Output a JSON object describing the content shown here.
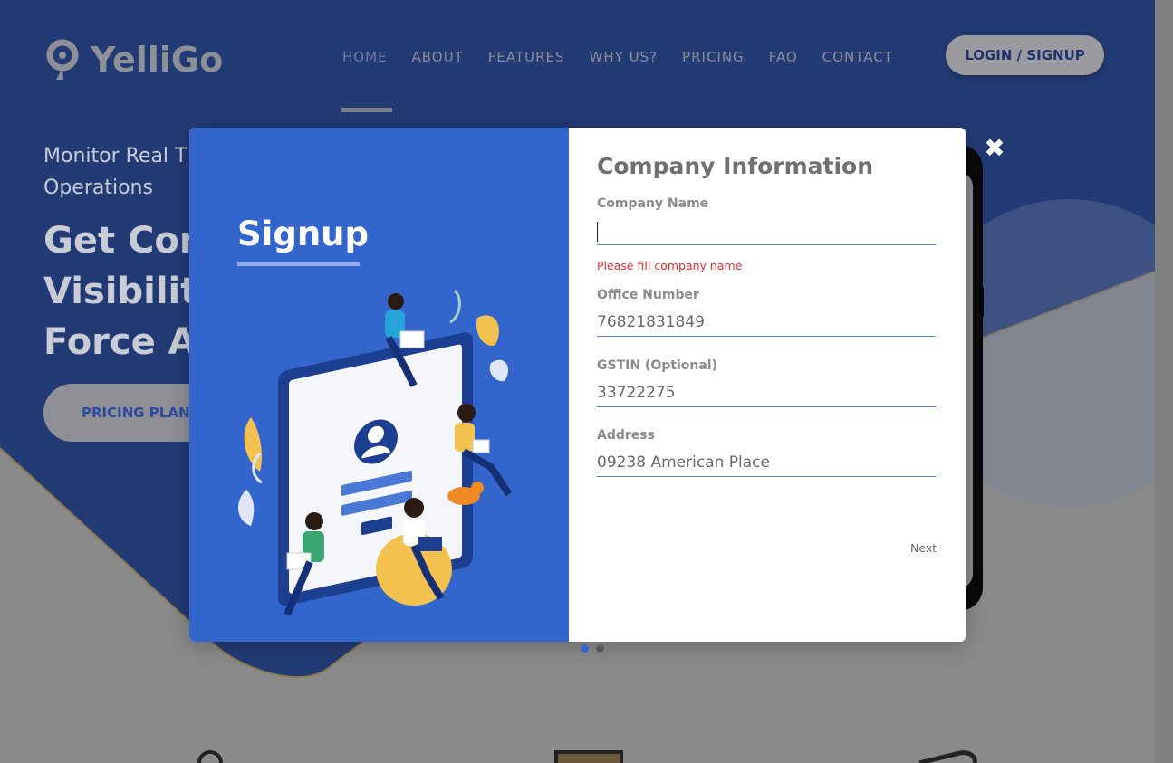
{
  "brand": {
    "name": "YelliGo"
  },
  "nav": {
    "items": [
      {
        "label": "HOME"
      },
      {
        "label": "ABOUT"
      },
      {
        "label": "FEATURES"
      },
      {
        "label": "WHY US?"
      },
      {
        "label": "PRICING"
      },
      {
        "label": "FAQ"
      },
      {
        "label": "CONTACT"
      }
    ],
    "login_label": "LOGIN / SIGNUP"
  },
  "hero": {
    "subtitle_line1": "Monitor Real T",
    "subtitle_line2": "Operations",
    "title_line1": "Get Com",
    "title_line2": "Visibilit",
    "title_line3": "Force A",
    "pricing_label": "PRICING PLAN"
  },
  "modal": {
    "left_title": "Signup",
    "form_title": "Company Information",
    "fields": [
      {
        "label": "Company Name",
        "value": "",
        "error": "Please fill company name"
      },
      {
        "label": "Office Number",
        "value": "76821831849"
      },
      {
        "label": "GSTIN (Optional)",
        "value": "33722275"
      },
      {
        "label": "Address",
        "value": "09238 American Place"
      }
    ],
    "next_label": "Next",
    "close_glyph": "✖",
    "slides": {
      "count": 2,
      "active": 1
    }
  },
  "colors": {
    "modal_accent": "#3366cc",
    "error": "#e03030",
    "overlay": "#8a8a8a"
  }
}
